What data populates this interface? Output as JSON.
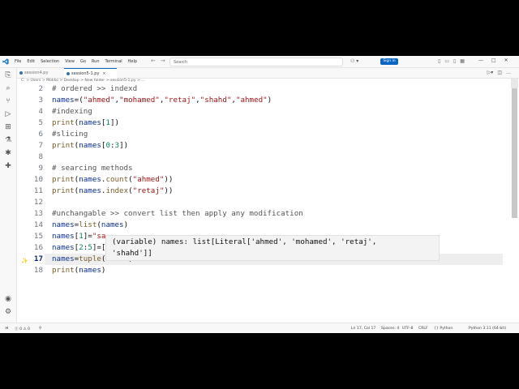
{
  "titlebar": {
    "menu": [
      "File",
      "Edit",
      "Selection",
      "View",
      "Go",
      "Run",
      "Terminal",
      "Help"
    ],
    "search_placeholder": "Search",
    "signin": "Sign in"
  },
  "tabs": [
    {
      "label": "session4.py",
      "active": false
    },
    {
      "label": "session5-1.py",
      "active": true,
      "close": "×"
    }
  ],
  "breadcrumb": "C: > Users > Mokko > Desktop > New folder > session5-1.py > ...",
  "code_lines": [
    {
      "n": "2",
      "segs": [
        [
          "c-com",
          "# ordered >> indexd"
        ]
      ]
    },
    {
      "n": "3",
      "segs": [
        [
          "c-var",
          "names"
        ],
        [
          "c-p",
          "=("
        ],
        [
          "c-str",
          "\"ahmed\""
        ],
        [
          "c-p",
          ","
        ],
        [
          "c-str",
          "\"mohamed\""
        ],
        [
          "c-p",
          ","
        ],
        [
          "c-str",
          "\"retaj\""
        ],
        [
          "c-p",
          ","
        ],
        [
          "c-str",
          "\"shahd\""
        ],
        [
          "c-p",
          ","
        ],
        [
          "c-str",
          "\"ahmed\""
        ],
        [
          "c-p",
          ")"
        ]
      ]
    },
    {
      "n": "4",
      "segs": [
        [
          "c-com",
          "#indexing"
        ]
      ]
    },
    {
      "n": "5",
      "segs": [
        [
          "c-fn",
          "print"
        ],
        [
          "c-p",
          "("
        ],
        [
          "c-var",
          "names"
        ],
        [
          "c-p",
          "["
        ],
        [
          "c-num",
          "1"
        ],
        [
          "c-p",
          "])"
        ]
      ]
    },
    {
      "n": "6",
      "segs": [
        [
          "c-com",
          "#slicing"
        ]
      ]
    },
    {
      "n": "7",
      "segs": [
        [
          "c-fn",
          "print"
        ],
        [
          "c-p",
          "("
        ],
        [
          "c-var",
          "names"
        ],
        [
          "c-p",
          "["
        ],
        [
          "c-num",
          "0"
        ],
        [
          "c-p",
          ":"
        ],
        [
          "c-num",
          "3"
        ],
        [
          "c-p",
          "])"
        ]
      ]
    },
    {
      "n": "8",
      "segs": []
    },
    {
      "n": "9",
      "segs": [
        [
          "c-com",
          "# searcing methods"
        ]
      ]
    },
    {
      "n": "10",
      "segs": [
        [
          "c-fn",
          "print"
        ],
        [
          "c-p",
          "("
        ],
        [
          "c-var",
          "names"
        ],
        [
          "c-p",
          "."
        ],
        [
          "c-fn",
          "count"
        ],
        [
          "c-p",
          "("
        ],
        [
          "c-str",
          "\"ahmed\""
        ],
        [
          "c-p",
          "))"
        ]
      ]
    },
    {
      "n": "11",
      "segs": [
        [
          "c-fn",
          "print"
        ],
        [
          "c-p",
          "("
        ],
        [
          "c-var",
          "names"
        ],
        [
          "c-p",
          "."
        ],
        [
          "c-fn",
          "index"
        ],
        [
          "c-p",
          "("
        ],
        [
          "c-str",
          "\"retaj\""
        ],
        [
          "c-p",
          "))"
        ]
      ]
    },
    {
      "n": "12",
      "segs": []
    },
    {
      "n": "13",
      "segs": [
        [
          "c-com",
          "#unchangable >> convert list then apply any modification"
        ]
      ]
    },
    {
      "n": "14",
      "segs": [
        [
          "c-var",
          "names"
        ],
        [
          "c-p",
          "="
        ],
        [
          "c-fn",
          "list"
        ],
        [
          "c-p",
          "("
        ],
        [
          "c-var",
          "names"
        ],
        [
          "c-p",
          ")"
        ]
      ]
    },
    {
      "n": "15",
      "segs": [
        [
          "c-var",
          "names"
        ],
        [
          "c-p",
          "["
        ],
        [
          "c-num",
          "1"
        ],
        [
          "c-p",
          "]="
        ],
        [
          "c-str",
          "\"sa"
        ]
      ]
    },
    {
      "n": "16",
      "segs": [
        [
          "c-var",
          "names"
        ],
        [
          "c-p",
          "["
        ],
        [
          "c-num",
          "2"
        ],
        [
          "c-p",
          ":"
        ],
        [
          "c-num",
          "5"
        ],
        [
          "c-p",
          "]=["
        ]
      ]
    },
    {
      "n": "17",
      "segs": [
        [
          "c-var",
          "names"
        ],
        [
          "c-p",
          "="
        ],
        [
          "c-fn",
          "tuple"
        ],
        [
          "c-p",
          "("
        ],
        [
          "c-var",
          "names"
        ],
        [
          "c-p",
          ")"
        ]
      ],
      "current": true
    },
    {
      "n": "18",
      "segs": [
        [
          "c-fn",
          "print"
        ],
        [
          "c-p",
          "("
        ],
        [
          "c-var",
          "names"
        ],
        [
          "c-p",
          ")"
        ]
      ]
    }
  ],
  "hover": {
    "line1": "(variable) names: list[Literal['ahmed', 'mohamed', 'retaj',",
    "line2": "'shahd']]"
  },
  "status": {
    "position": "Ln 17, Col 17",
    "spaces": "Spaces: 4",
    "encoding": "UTF-8",
    "eol": "CRLF",
    "language": "Python",
    "interpreter": "Python 3.11 (64-bit)",
    "errors": "0",
    "warnings": "0"
  },
  "colors": {
    "accent": "#0a66c2",
    "comment": "#555555",
    "string": "#a31515",
    "number": "#098658",
    "variable": "#0a2f8a",
    "function": "#795e26"
  }
}
